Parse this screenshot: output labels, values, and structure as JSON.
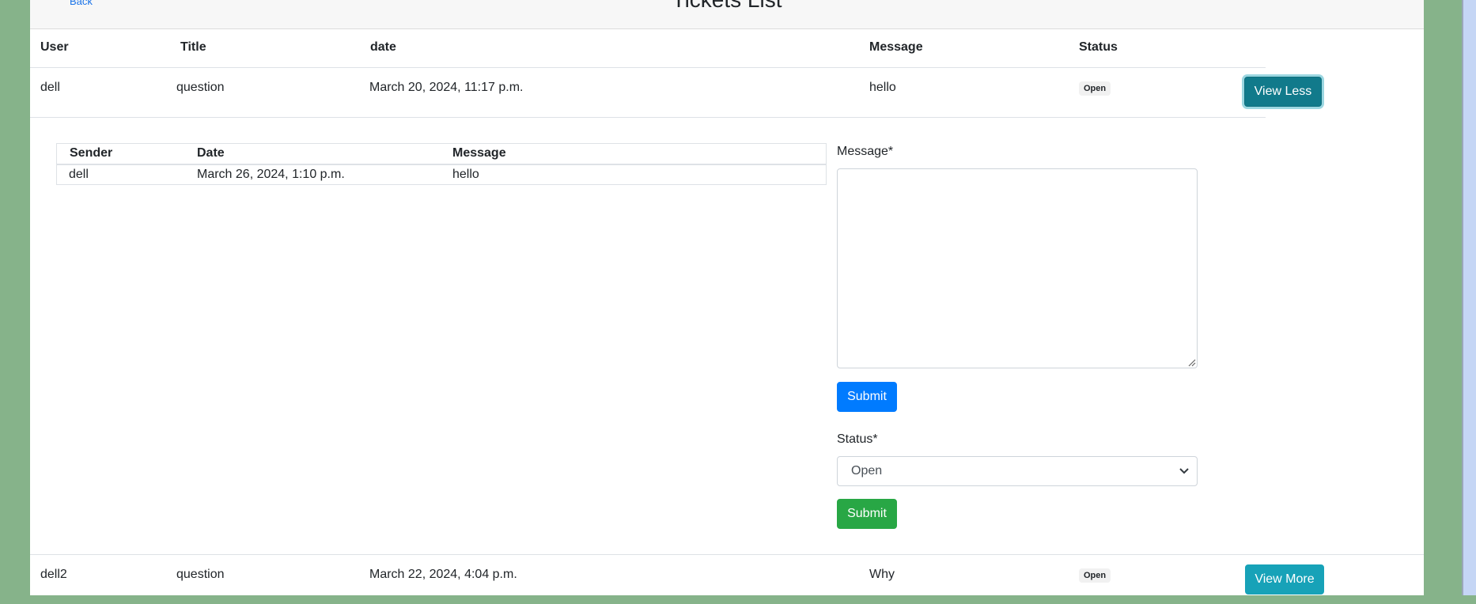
{
  "header": {
    "back_label": "Back",
    "title": "Tickets List"
  },
  "table": {
    "columns": [
      "User",
      "Title",
      "date",
      "Message",
      "Status"
    ],
    "rows": [
      {
        "user": "dell",
        "title": "question",
        "date": "March 20, 2024, 11:17 p.m.",
        "message": "hello",
        "status": "Open",
        "action": "View Less"
      },
      {
        "user": "dell2",
        "title": "question",
        "date": "March 22, 2024, 4:04 p.m.",
        "message": "Why",
        "status": "Open",
        "action": "View More"
      }
    ]
  },
  "detail": {
    "messages_table": {
      "columns": [
        "Sender",
        "Date",
        "Message"
      ],
      "rows": [
        {
          "sender": "dell",
          "date": "March 26, 2024, 1:10 p.m.",
          "message": "hello"
        }
      ]
    },
    "message_form": {
      "label": "Message*",
      "value": "",
      "submit_label": "Submit"
    },
    "status_form": {
      "label": "Status*",
      "selected": "Open",
      "submit_label": "Submit"
    }
  },
  "colors": {
    "page_background": "#86b38a",
    "teal_button": "#17a2b8",
    "blue_button": "#007bff",
    "green_button": "#28a745"
  },
  "icons": [
    "chevron-down-icon",
    "resize-grip-icon"
  ]
}
